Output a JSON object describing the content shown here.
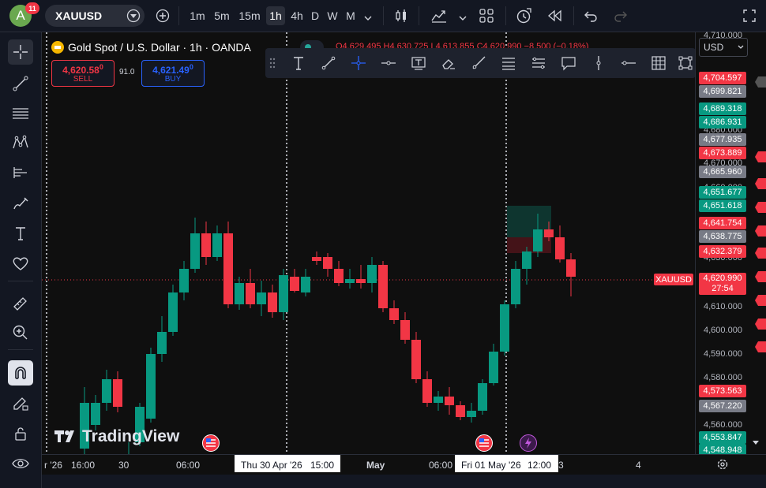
{
  "header": {
    "avatar_letter": "A",
    "notification_count": "11",
    "symbol": "XAUUSD",
    "timeframes": [
      "1m",
      "5m",
      "15m",
      "1h",
      "4h",
      "D",
      "W",
      "M"
    ],
    "active_timeframe": "1h"
  },
  "legend": {
    "title": "Gold Spot / U.S. Dollar · 1h · OANDA",
    "ohlc": "O4,629.495 H4,630.725 L4,613.855 C4,620.990 −8.500 (−0.18%)"
  },
  "trade": {
    "sell_price": "4,620.58",
    "sell_sup": "0",
    "sell_label": "SELL",
    "spread": "91.0",
    "buy_price": "4,621.49",
    "buy_sup": "0",
    "buy_label": "BUY"
  },
  "price_scale": {
    "currency": "USD",
    "ticks": [
      "4,710.000",
      "4,680.000",
      "4,670.000",
      "4,660.000",
      "4,630.000",
      "4,610.000",
      "4,600.000",
      "4,590.000",
      "4,580.000",
      "4,560.000"
    ],
    "labels": [
      {
        "text": "4,704.597",
        "color": "#f23645"
      },
      {
        "text": "4,699.821",
        "color": "#787b86"
      },
      {
        "text": "4,689.318",
        "color": "#089981"
      },
      {
        "text": "4,686.931",
        "color": "#089981"
      },
      {
        "text": "4,677.935",
        "color": "#787b86"
      },
      {
        "text": "4,673.889",
        "color": "#f23645"
      },
      {
        "text": "4,665.960",
        "color": "#787b86"
      },
      {
        "text": "4,651.677",
        "color": "#089981"
      },
      {
        "text": "4,651.618",
        "color": "#089981"
      },
      {
        "text": "4,641.754",
        "color": "#f23645"
      },
      {
        "text": "4,638.775",
        "color": "#787b86"
      },
      {
        "text": "4,632.379",
        "color": "#f23645"
      },
      {
        "text": "4,573.563",
        "color": "#f23645"
      },
      {
        "text": "4,567.220",
        "color": "#787b86"
      },
      {
        "text": "4,553.847",
        "color": "#089981"
      },
      {
        "text": "4,548.948",
        "color": "#089981"
      }
    ],
    "current_price": "4,620.990",
    "countdown": "27:54",
    "symbol_tag": "XAUUSD"
  },
  "time_scale": {
    "ticks": [
      "r '26",
      "16:00",
      "30",
      "06:00",
      "May",
      "06:00",
      "3",
      "4"
    ],
    "cursor_labels": [
      "Thu 30 Apr '26",
      "15:00",
      "Fri 01 May '26",
      "12:00"
    ]
  },
  "watermark": "TradingView",
  "colors": {
    "up": "#089981",
    "down": "#f23645",
    "bg": "#0f0f0f",
    "accent": "#2962ff"
  }
}
